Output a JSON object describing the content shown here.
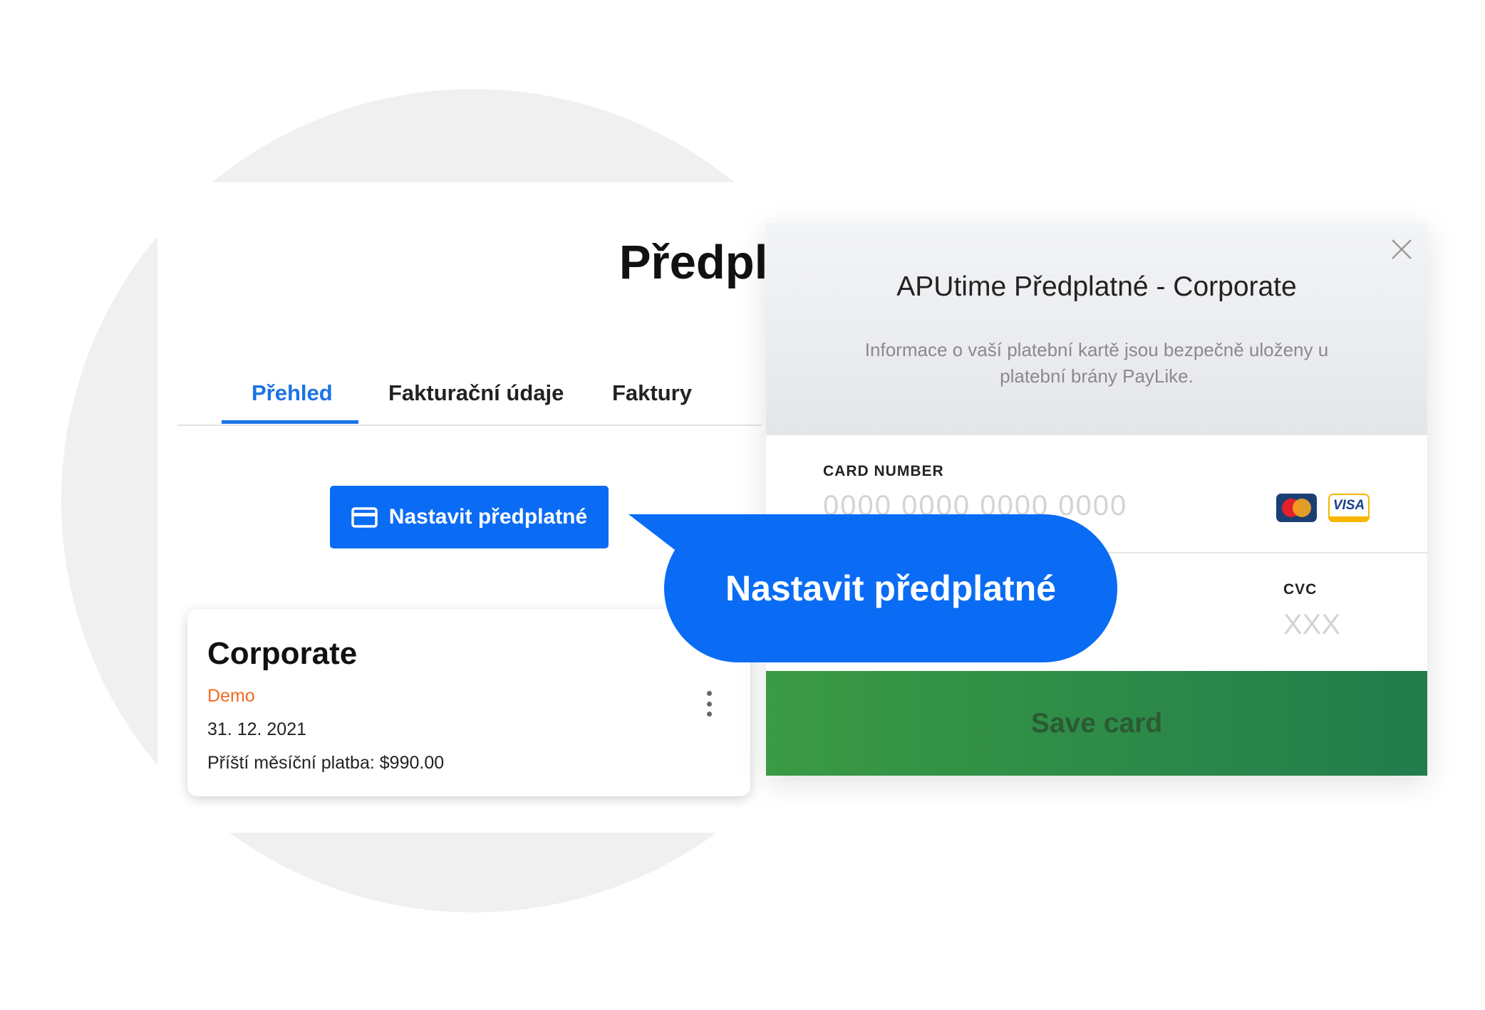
{
  "subscription_page": {
    "title": "Předplatné",
    "tabs": [
      {
        "label": "Přehled",
        "active": true
      },
      {
        "label": "Fakturační údaje",
        "active": false
      },
      {
        "label": "Faktury",
        "active": false
      }
    ],
    "setup_button_label": "Nastavit předplatné",
    "plan": {
      "name": "Corporate",
      "badge": "Demo",
      "date": "31. 12. 2021",
      "next_payment": "Příští měsíční platba: $990.00"
    }
  },
  "payment_modal": {
    "title": "APUtime Předplatné - Corporate",
    "info": "Informace o vaší platební kartě jsou bezpečně uloženy u platební brány PayLike.",
    "card_number_label": "CARD NUMBER",
    "card_number_placeholder": "0000 0000 0000 0000",
    "cvc_label": "CVC",
    "cvc_placeholder": "XXX",
    "card_brands": [
      {
        "name": "mastercard-icon",
        "text": "MasterCard"
      },
      {
        "name": "visa-icon",
        "text": "VISA"
      }
    ],
    "save_button_label": "Save card"
  },
  "callout": {
    "text": "Nastavit předplatné"
  },
  "colors": {
    "primary_blue": "#0a6cf5",
    "tab_active": "#1a73e8",
    "badge_orange": "#f26a21",
    "save_green": "#2f8b48"
  }
}
